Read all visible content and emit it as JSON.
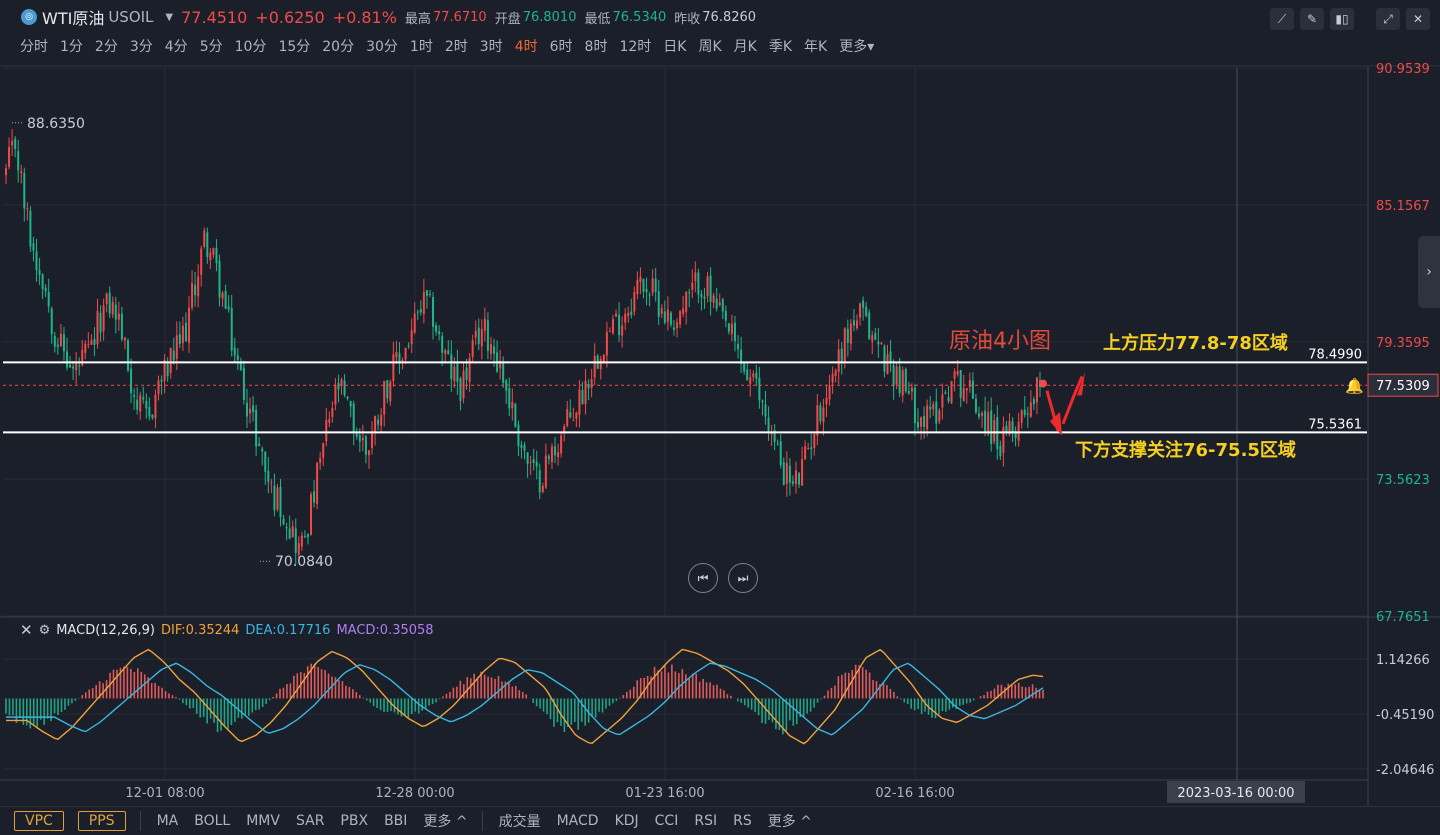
{
  "header": {
    "logo": "◎",
    "symbol_name": "WTI原油",
    "symbol_code": "USOIL",
    "price": "77.4510",
    "change": "+0.6250",
    "change_pct": "+0.81%",
    "high_label": "最高",
    "high": "77.6710",
    "open_label": "开盘",
    "open": "76.8010",
    "low_label": "最低",
    "low": "76.5340",
    "prev_label": "昨收",
    "prev": "76.8260"
  },
  "timeframes": [
    "分时",
    "1分",
    "2分",
    "3分",
    "4分",
    "5分",
    "10分",
    "15分",
    "20分",
    "30分",
    "1时",
    "2时",
    "3时",
    "4时",
    "6时",
    "8时",
    "12时",
    "日K",
    "周K",
    "月K",
    "季K",
    "年K",
    "更多▾"
  ],
  "active_timeframe": "4时",
  "toolbar_icons": [
    "indicator-icon",
    "draw-icon",
    "candle-type-icon",
    "fullscreen-icon",
    "close-icon"
  ],
  "annotations": {
    "title": "原油4小图",
    "resistance": "上方压力77.8-78区域",
    "support": "下方支撑关注76-75.5区域"
  },
  "macd_header": {
    "name": "MACD(12,26,9)",
    "dif": "DIF:0.35244",
    "dea": "DEA:0.17716",
    "macd": "MACD:0.35058"
  },
  "bottom_left": [
    "VPC",
    "PPS"
  ],
  "bottom_main_indicators": [
    "MA",
    "BOLL",
    "MMV",
    "SAR",
    "PBX",
    "BBI",
    "更多 ^"
  ],
  "bottom_sub_indicators": [
    "成交量",
    "MACD",
    "KDJ",
    "CCI",
    "RSI",
    "RS",
    "更多 ^"
  ],
  "colors": {
    "up": "#f04a4a",
    "down": "#1fb58a",
    "dif": "#f0a23c",
    "dea": "#3ab6e0",
    "bg": "#1b1f2a"
  },
  "chart_data": {
    "type": "candlestick",
    "price_axis_ticks": [
      "90.9539",
      "85.1567",
      "79.3595",
      "73.5623",
      "67.7651"
    ],
    "macd_axis_ticks": [
      "1.14266",
      "-0.45190",
      "-2.04646"
    ],
    "x_tick_labels": [
      "12-01 08:00",
      "12-28 00:00",
      "01-23 16:00",
      "02-16 16:00"
    ],
    "crosshair_time_label": "2023-03-16 00:00",
    "price_ylim": [
      67.7651,
      90.9539
    ],
    "macd_ylim": [
      -2.04646,
      1.14266
    ],
    "high_marker": "88.6350",
    "low_marker": "70.0840",
    "current_price": "77.5309",
    "resistance_line": "78.4990",
    "support_line": "75.5361",
    "close_path": [
      86.5,
      87.8,
      85,
      83,
      82,
      80,
      79,
      78,
      78.5,
      79,
      80.5,
      81,
      80.2,
      78,
      76.5,
      76,
      77.5,
      78.2,
      79,
      80,
      82,
      83.8,
      82.6,
      81,
      79,
      77.5,
      76,
      74.5,
      73,
      72.5,
      71.5,
      70.5,
      72,
      74,
      76,
      77.5,
      76.5,
      75.5,
      74.8,
      76,
      77.5,
      78.3,
      79,
      80,
      81,
      80.5,
      79,
      78,
      77.5,
      78.5,
      80,
      79.5,
      78.5,
      77,
      75.5,
      74.2,
      73.5,
      74.2,
      75,
      75.8,
      76.5,
      77.5,
      78.5,
      79.5,
      80,
      80.5,
      81.2,
      82,
      81.5,
      81,
      80.2,
      80.5,
      81.2,
      82,
      81.5,
      80.5,
      80,
      79,
      78,
      77.4,
      76.5,
      75,
      74,
      73.2,
      74,
      75.5,
      76.8,
      77.8,
      79,
      80,
      80.5,
      79.8,
      79.2,
      78.4,
      78,
      77.2,
      76.5,
      76,
      76.5,
      77.3,
      77.8,
      77.6,
      77,
      76.3,
      75.6,
      75,
      75.5,
      76.3,
      77,
      77.45
    ],
    "macd_hist": [
      -0.55,
      -0.8,
      -1.0,
      -0.7,
      -0.3,
      0.1,
      0.5,
      0.9,
      1.1,
      0.8,
      0.4,
      0.1,
      -0.3,
      -0.7,
      -1.05,
      -0.9,
      -0.6,
      -0.2,
      0.3,
      0.8,
      1.05,
      0.9,
      0.6,
      0.2,
      -0.2,
      -0.5,
      -0.7,
      -0.5,
      -0.2,
      0.2,
      0.6,
      0.9,
      0.8,
      0.5,
      0.2,
      -0.4,
      -0.9,
      -1.1,
      -0.8,
      -0.5,
      -0.1,
      0.4,
      0.8,
      1.1,
      1.0,
      0.8,
      0.6,
      0.3,
      -0.1,
      -0.5,
      -0.9,
      -1.1,
      -0.7,
      -0.3,
      0.3,
      0.9,
      1.1,
      0.7,
      0.3,
      -0.2,
      -0.5,
      -0.6,
      -0.4,
      -0.2,
      0.1,
      0.4,
      0.5,
      0.45,
      0.35
    ]
  }
}
